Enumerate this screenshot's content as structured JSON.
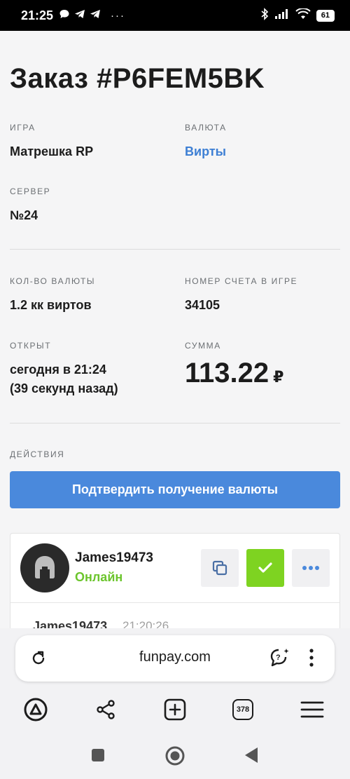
{
  "status_bar": {
    "time": "21:25",
    "battery": "61"
  },
  "order": {
    "title": "Заказ #P6FEM5BK",
    "game_label": "ИГРА",
    "game_value": "Матрешка RP",
    "currency_label": "ВАЛЮТА",
    "currency_value": "Вирты",
    "server_label": "СЕРВЕР",
    "server_value": "№24",
    "amount_label": "КОЛ-ВО ВАЛЮТЫ",
    "amount_value": "1.2 кк виртов",
    "account_label": "НОМЕР СЧЕТА В ИГРЕ",
    "account_value": "34105",
    "opened_label": "ОТКРЫТ",
    "opened_value_line1": "сегодня в 21:24",
    "opened_value_line2": "(39 секунд назад)",
    "sum_label": "СУММА",
    "sum_value": "113.22",
    "sum_currency": "₽"
  },
  "actions": {
    "label": "ДЕЙСТВИЯ",
    "confirm_button": "Подтвердить получение валюты"
  },
  "chat": {
    "user_name": "James19473",
    "user_status": "Онлайн",
    "last_message_author": "James19473",
    "last_message_time": "21:20:26"
  },
  "browser": {
    "url": "funpay.com",
    "tab_count": "378"
  },
  "colors": {
    "accent_blue": "#4a89dc",
    "link_blue": "#3d7fd4",
    "online_green": "#6cc52d",
    "confirm_green": "#7ed321"
  }
}
